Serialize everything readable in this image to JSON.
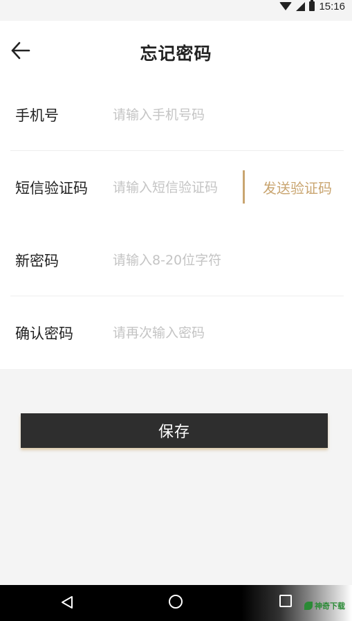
{
  "status_bar": {
    "time": "15:16",
    "icons": [
      "wifi-icon",
      "signal-icon",
      "battery-icon"
    ]
  },
  "header": {
    "title": "忘记密码",
    "back_icon": "arrow-left-icon"
  },
  "form": {
    "phone": {
      "label": "手机号",
      "placeholder": "请输入手机号码",
      "value": ""
    },
    "sms_code": {
      "label": "短信验证码",
      "placeholder": "请输入短信验证码",
      "value": "",
      "send_label": "发送验证码"
    },
    "new_password": {
      "label": "新密码",
      "placeholder": "请输入8-20位字符",
      "value": ""
    },
    "confirm_password": {
      "label": "确认密码",
      "placeholder": "请再次输入密码",
      "value": ""
    }
  },
  "actions": {
    "save_label": "保存"
  },
  "nav_bar": {
    "icons": [
      "nav-back-icon",
      "nav-home-icon",
      "nav-recent-icon"
    ],
    "watermark": "神奇下载"
  },
  "colors": {
    "accent": "#c9a570",
    "button_bg": "#2e2e2e",
    "page_bg": "#f4f4f4",
    "placeholder": "#c4c4c4"
  }
}
